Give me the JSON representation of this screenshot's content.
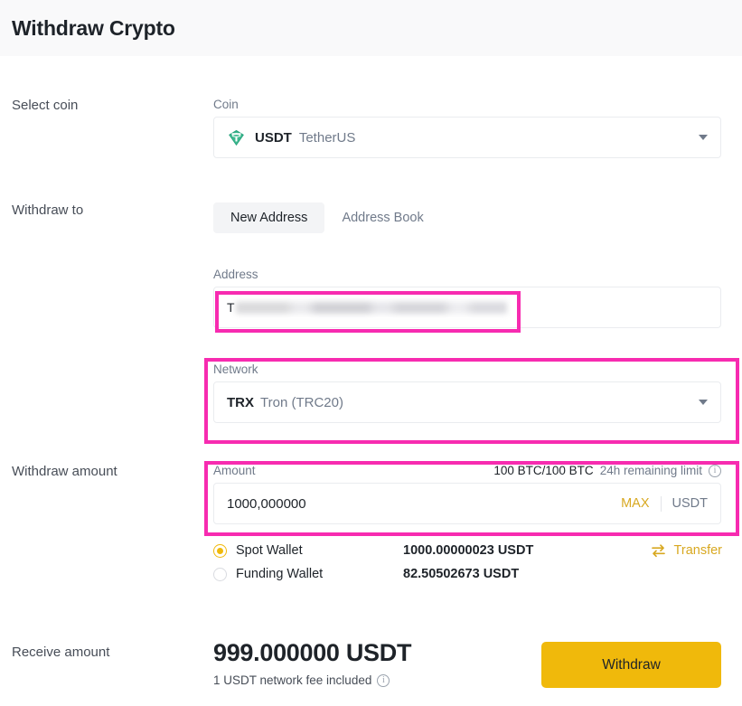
{
  "header": {
    "title": "Withdraw Crypto"
  },
  "select_coin": {
    "label": "Select coin",
    "caption": "Coin",
    "coin_symbol": "USDT",
    "coin_name": "TetherUS",
    "icon": "usdt-coin-icon",
    "caret": "chevron-down-icon"
  },
  "withdraw_to": {
    "label": "Withdraw to",
    "tabs": [
      {
        "label": "New Address",
        "active": true
      },
      {
        "label": "Address Book",
        "active": false
      }
    ],
    "address": {
      "caption": "Address",
      "value": "T",
      "masked": true
    },
    "network": {
      "caption": "Network",
      "symbol": "TRX",
      "name": "Tron (TRC20)",
      "caret": "chevron-down-icon"
    }
  },
  "withdraw_amount": {
    "label": "Withdraw amount",
    "caption": "Amount",
    "limit_value": "100 BTC/100 BTC",
    "limit_label": "24h remaining limit",
    "limit_info_icon": "info-icon",
    "value": "1000,000000",
    "max_label": "MAX",
    "unit": "USDT",
    "wallets": [
      {
        "name": "Spot Wallet",
        "balance": "1000.00000023 USDT",
        "selected": true
      },
      {
        "name": "Funding Wallet",
        "balance": "82.50502673 USDT",
        "selected": false
      }
    ],
    "transfer_label": "Transfer",
    "transfer_icon": "swap-arrows-icon"
  },
  "receive": {
    "label": "Receive amount",
    "amount": "999.000000 USDT",
    "fee_note": "1 USDT network fee included",
    "fee_info_icon": "info-icon"
  },
  "actions": {
    "withdraw_label": "Withdraw"
  },
  "colors": {
    "accent_gold": "#f0b90b",
    "highlight_pink": "#f72bb0",
    "text_primary": "#1e2329",
    "text_secondary": "#707a8a"
  }
}
